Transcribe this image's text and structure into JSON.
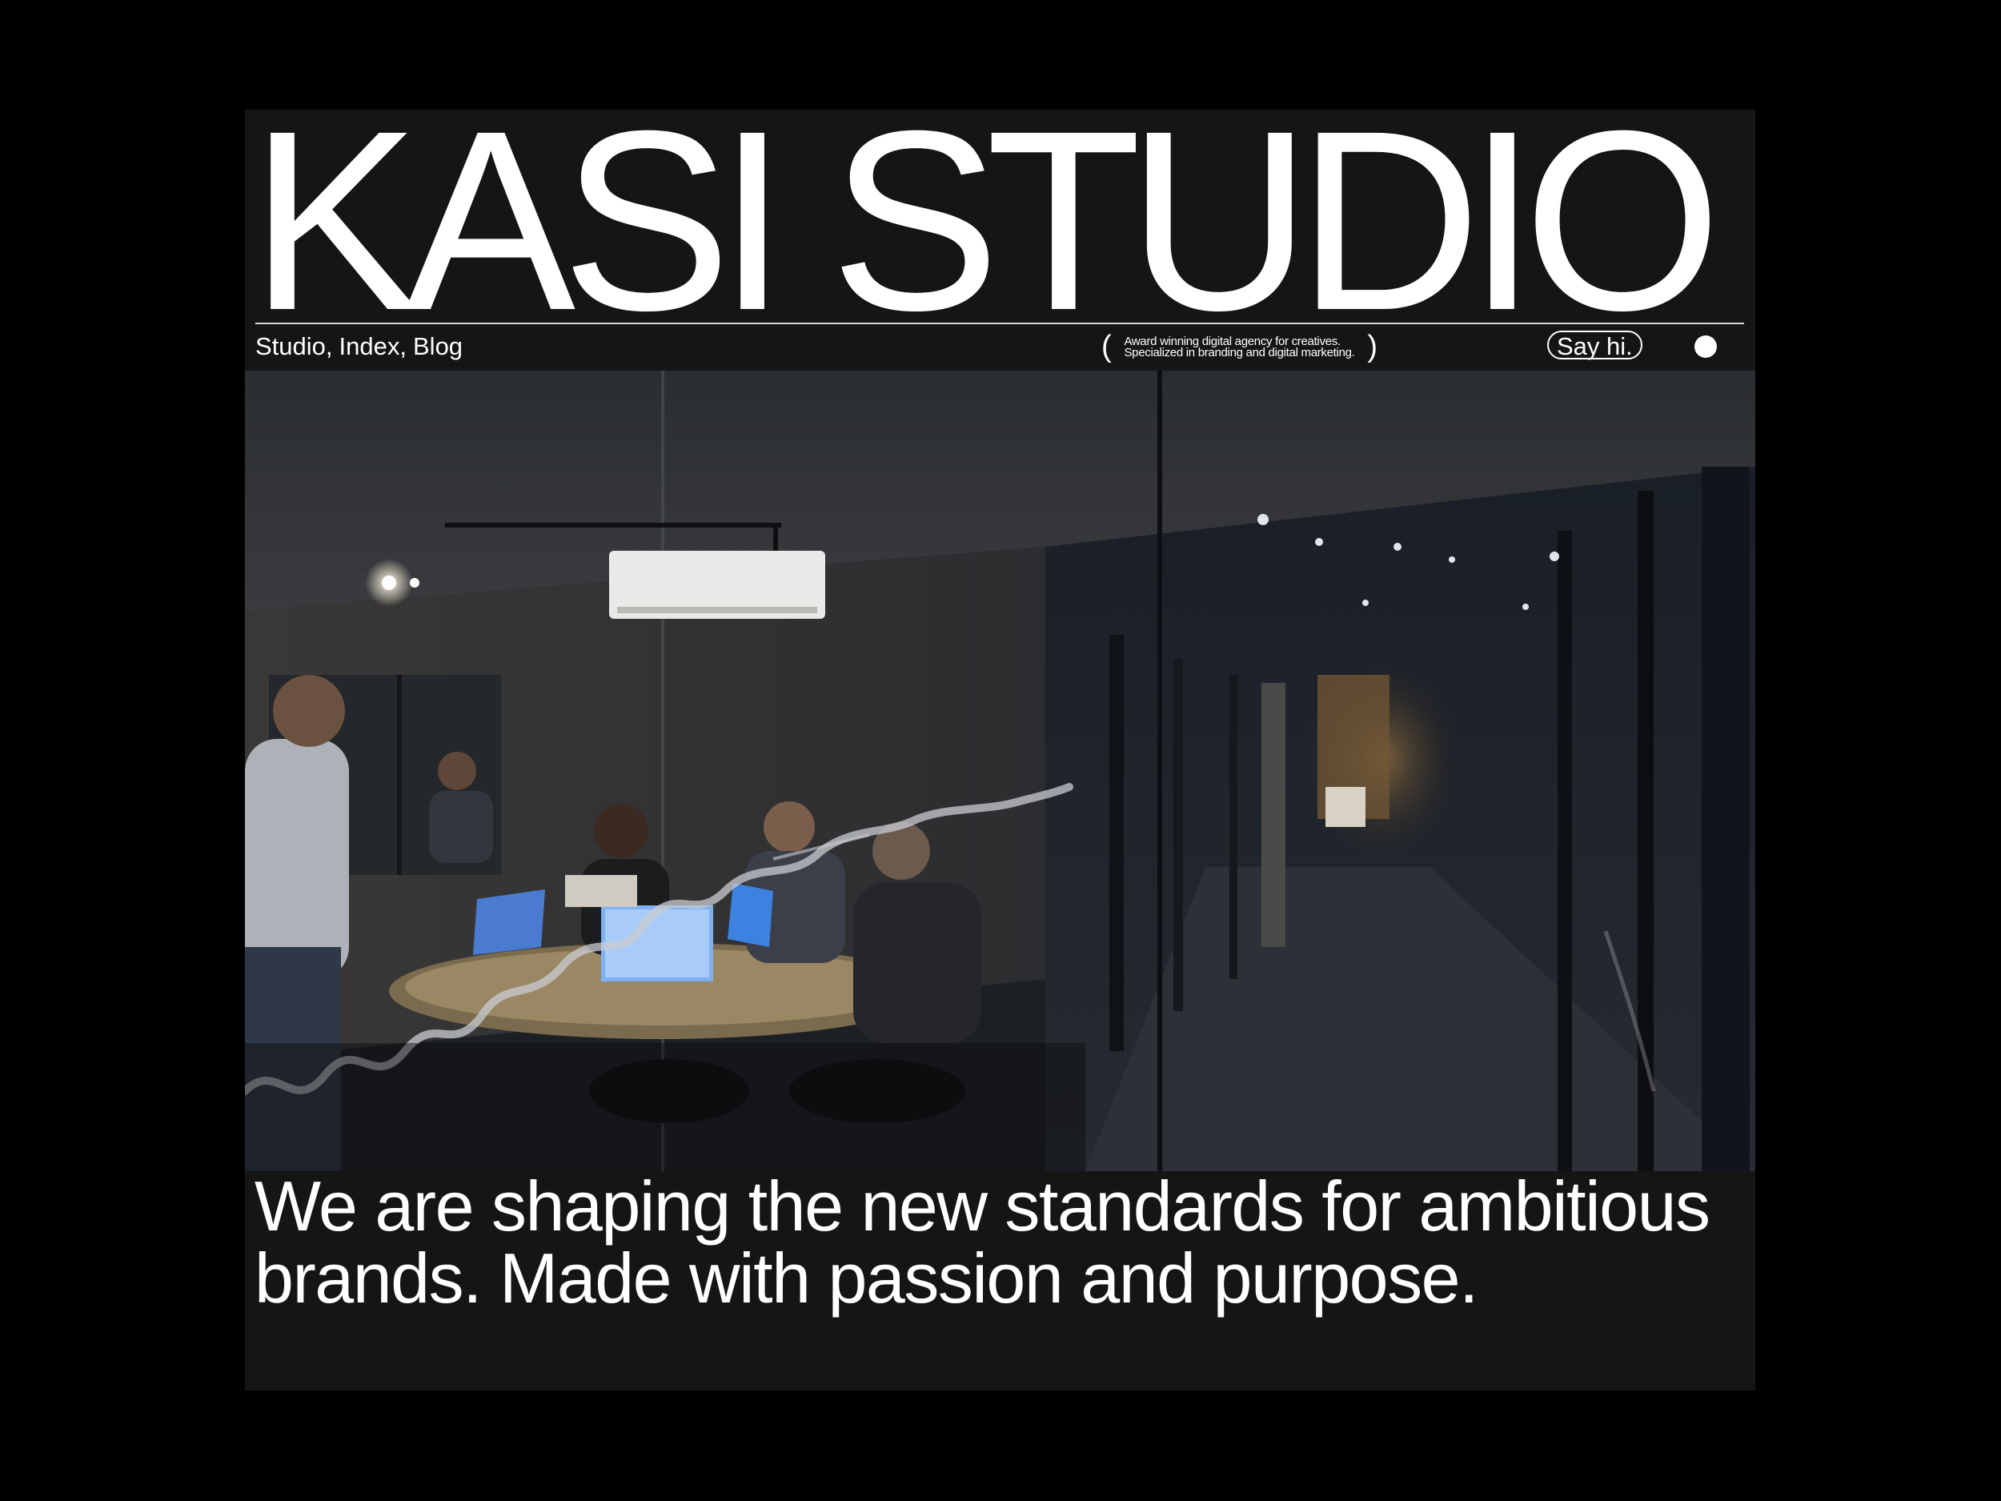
{
  "brand": {
    "name": "KASI STUDIO"
  },
  "nav": {
    "items": [
      "Studio",
      "Index",
      "Blog"
    ],
    "separator": ", "
  },
  "tagline": {
    "open": "(",
    "line1": "Award winning digital agency for creatives.",
    "line2": "Specialized in branding and digital marketing.",
    "close": ")"
  },
  "cta": {
    "label": "Say hi."
  },
  "menu": {
    "icon": "circle-dot-icon"
  },
  "hero_image": {
    "subject": "office-meeting-photo"
  },
  "headline": {
    "text": "We are shaping the new standards for ambitious brands. Made with passion and purpose."
  },
  "colors": {
    "page_background": "#000000",
    "frame_background": "#151515",
    "text": "#ffffff"
  }
}
